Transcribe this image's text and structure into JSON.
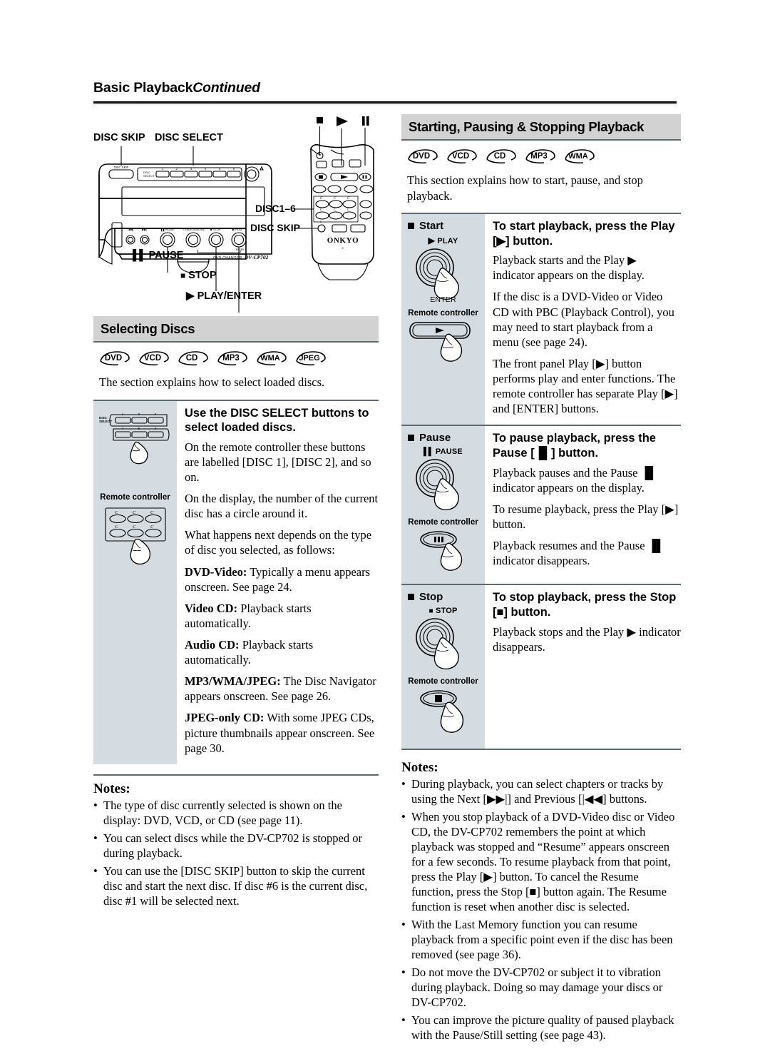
{
  "runhead": {
    "main": "Basic Playback",
    "continued": "Continued"
  },
  "top_illustration": {
    "labels": {
      "disc_skip": "DISC SKIP",
      "disc_select": "DISC SELECT",
      "pause": "PAUSE",
      "stop": "STOP",
      "play_enter": "PLAY/ENTER",
      "disc1_6": "DISC1–6",
      "disc_skip_remote": "DISC SKIP"
    },
    "front_panel": {
      "brand_line": "DVD CHANGER",
      "model": "DV-CP702",
      "disc_select_label": "DISC SELECT",
      "disc_skip_label": "DISC SKIP",
      "disc_numbers": [
        "1",
        "2",
        "3",
        "4",
        "5",
        "6"
      ],
      "transport_labels": [
        "PAUSE",
        "CHARGE/MODE",
        "STOP",
        "PLAY"
      ]
    },
    "remote": {
      "brand": "ONKYO"
    }
  },
  "left_section": {
    "heading": "Selecting Discs",
    "badges": [
      "DVD",
      "VCD",
      "CD",
      "MP3",
      "WMA",
      "JPEG"
    ],
    "intro": "The section explains how to select loaded discs.",
    "figure": {
      "disc_select_label": "DISC SELECT",
      "numbers": [
        "1",
        "2",
        "3",
        "4",
        "5",
        "6"
      ],
      "remote_caption": "Remote controller",
      "remote_button_glyph": "C"
    },
    "title": "Use the DISC SELECT buttons to select loaded discs.",
    "paragraphs": [
      "On the remote controller these buttons are labelled [DISC 1], [DISC 2], and so on.",
      "On the display, the number of the current disc has a circle around it.",
      "What happens next depends on the type of disc you selected, as follows:"
    ],
    "disc_types": [
      {
        "term": "DVD-Video:",
        "desc": " Typically a menu appears onscreen. See page 24."
      },
      {
        "term": "Video CD:",
        "desc": " Playback starts automatically."
      },
      {
        "term": "Audio CD:",
        "desc": " Playback starts automatically."
      },
      {
        "term": "MP3/WMA/JPEG:",
        "desc": " The Disc Navigator appears onscreen. See page 26."
      },
      {
        "term": "JPEG-only CD:",
        "desc": " With some JPEG CDs, picture thumbnails appear onscreen. See page 30."
      }
    ],
    "notes_title": "Notes:",
    "notes": [
      "The type of disc currently selected is shown on the display: DVD, VCD, or CD (see page 11).",
      "You can select discs while the DV-CP702 is stopped or during playback.",
      "You can use the [DISC SKIP] button to skip the current disc and start the next disc. If disc #6 is the current disc, disc #1 will be selected next."
    ]
  },
  "right_section": {
    "heading": "Starting, Pausing & Stopping Playback",
    "badges": [
      "DVD",
      "VCD",
      "CD",
      "MP3",
      "WMA"
    ],
    "intro": "This section explains how to start, pause, and stop playback.",
    "steps": [
      {
        "label": "Start",
        "button_caption": "PLAY",
        "button_glyph": "▶",
        "sub_caption": "ENTER",
        "remote_caption": "Remote controller",
        "remote_glyph": "▶",
        "title": "To start playback, press the Play [▶] button.",
        "paragraphs": [
          "Playback starts and the Play ▶ indicator appears on the display.",
          "If the disc is a DVD-Video or Video CD with PBC (Playback Control), you may need to start playback from a menu (see page 24).",
          "The front panel Play [▶] button performs play and enter functions. The remote controller has separate Play [▶] and [ENTER] buttons."
        ]
      },
      {
        "label": "Pause",
        "button_caption": "PAUSE",
        "button_glyph": "▐▌",
        "sub_caption": "",
        "remote_caption": "Remote controller",
        "remote_glyph": "▐▌",
        "title": "To pause playback, press the Pause [▐▌] button.",
        "paragraphs": [
          "Playback pauses and the Pause ▐▌ indicator appears on the display.",
          "To resume playback, press the Play [▶] button.",
          "Playback resumes and the Pause ▐▌ indicator disappears."
        ]
      },
      {
        "label": "Stop",
        "button_caption": "STOP",
        "button_glyph": "■",
        "sub_caption": "",
        "remote_caption": "Remote controller",
        "remote_glyph": "■",
        "title": "To stop playback, press the Stop [■] button.",
        "paragraphs": [
          "Playback stops and the Play ▶ indicator disappears."
        ]
      }
    ],
    "notes_title": "Notes:",
    "notes": [
      "During playback, you can select chapters or tracks by using the Next [▶▶|] and Previous [|◀◀] buttons.",
      "When you stop playback of a DVD-Video disc or Video CD, the DV-CP702 remembers the point at which playback was stopped and “Resume” appears onscreen for a few seconds. To resume playback from that point, press the Play [▶] button. To cancel the Resume function, press the Stop [■] button again. The Resume function is reset when another disc is selected.",
      "With the Last Memory function you can resume playback from a specific point even if the disc has been removed (see page 36).",
      "Do not move the DV-CP702 or subject it to vibration during playback. Doing so may damage your discs or DV-CP702.",
      "You can improve the picture quality of paused playback with the Pause/Still setting (see page 43)."
    ]
  },
  "colors": {
    "heading_bg": "#d2d2d2",
    "figure_bg": "#d5dce1",
    "rule": "#5d6a70"
  }
}
